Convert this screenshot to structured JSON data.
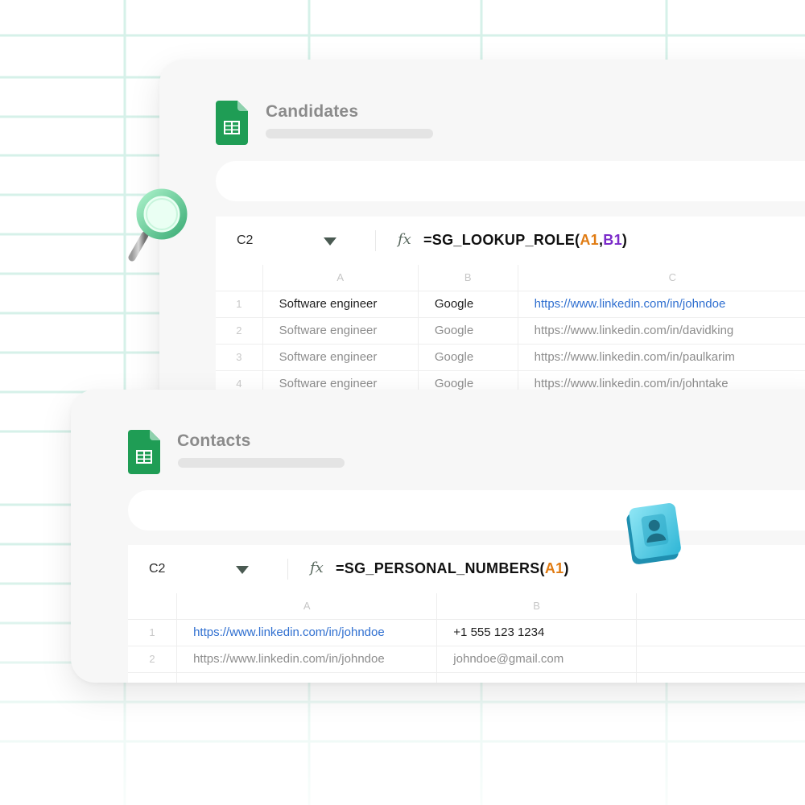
{
  "colors": {
    "grid_line": "#d6f1e9",
    "sheets_green": "#1f9d55",
    "link_blue": "#2f6fd0",
    "ref_orange": "#e07b12",
    "ref_purple": "#7b2bc9"
  },
  "candidates": {
    "title": "Candidates",
    "icon": "google-sheets-icon",
    "formula_bar": {
      "cell_ref": "C2",
      "fx": "fx",
      "formula_prefix": "=SG_LOOKUP_ROLE(",
      "arg1": "A1",
      "separator": ",",
      "arg2": "B1",
      "formula_suffix": ")"
    },
    "columns": [
      "A",
      "B",
      "C"
    ],
    "rows": [
      {
        "num": "1",
        "a": "Software engineer",
        "b": "Google",
        "c": "https://www.linkedin.com/in/johndoe"
      },
      {
        "num": "2",
        "a": "Software engineer",
        "b": "Google",
        "c": "https://www.linkedin.com/in/davidking"
      },
      {
        "num": "3",
        "a": "Software engineer",
        "b": "Google",
        "c": "https://www.linkedin.com/in/paulkarim"
      },
      {
        "num": "4",
        "a": "Software engineer",
        "b": "Google",
        "c": "https://www.linkedin.com/in/johntake"
      }
    ]
  },
  "contacts": {
    "title": "Contacts",
    "icon": "google-sheets-icon",
    "formula_bar": {
      "cell_ref": "C2",
      "fx": "fx",
      "formula_prefix": "=SG_PERSONAL_NUMBERS(",
      "arg1": "A1",
      "formula_suffix": ")"
    },
    "columns": [
      "A",
      "B"
    ],
    "rows": [
      {
        "num": "1",
        "a": "https://www.linkedin.com/in/johndoe",
        "b": "+1 555 123 1234"
      },
      {
        "num": "2",
        "a": "https://www.linkedin.com/in/johndoe",
        "b": "johndoe@gmail.com"
      }
    ]
  },
  "decorations": {
    "magnifier": "magnifying-glass-icon",
    "contact_book": "contact-book-icon"
  }
}
